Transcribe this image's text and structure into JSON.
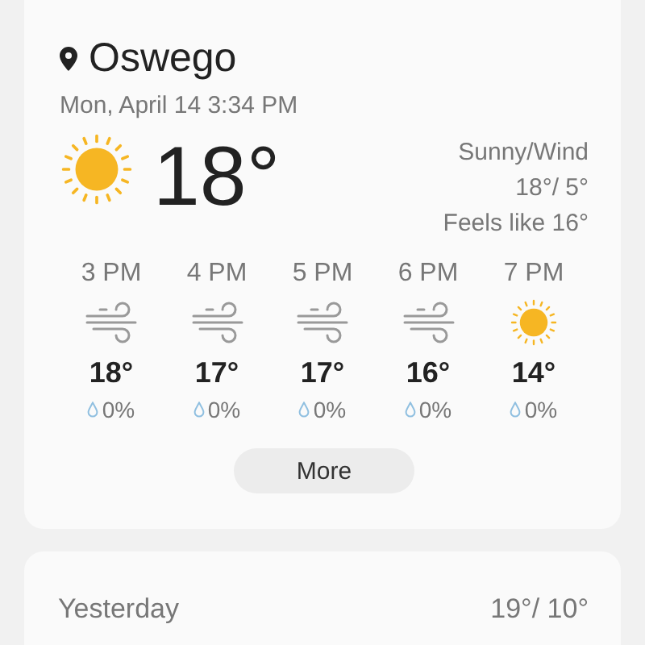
{
  "location": "Oswego",
  "datetime": "Mon, April 14 3:34 PM",
  "current": {
    "kind": "sunny",
    "temperature": "18°",
    "condition": "Sunny/Wind",
    "high_low": "18°/ 5°",
    "feels_like": "Feels like 16°"
  },
  "hourly": [
    {
      "time": "3 PM",
      "kind": "wind",
      "temperature": "18°",
      "precipitation": "0%"
    },
    {
      "time": "4 PM",
      "kind": "wind",
      "temperature": "17°",
      "precipitation": "0%"
    },
    {
      "time": "5 PM",
      "kind": "wind",
      "temperature": "17°",
      "precipitation": "0%"
    },
    {
      "time": "6 PM",
      "kind": "wind",
      "temperature": "16°",
      "precipitation": "0%"
    },
    {
      "time": "7 PM",
      "kind": "sunny",
      "temperature": "14°",
      "precipitation": "0%"
    }
  ],
  "more_button": "More",
  "yesterday": {
    "label": "Yesterday",
    "high_low": "19°/ 10°"
  }
}
